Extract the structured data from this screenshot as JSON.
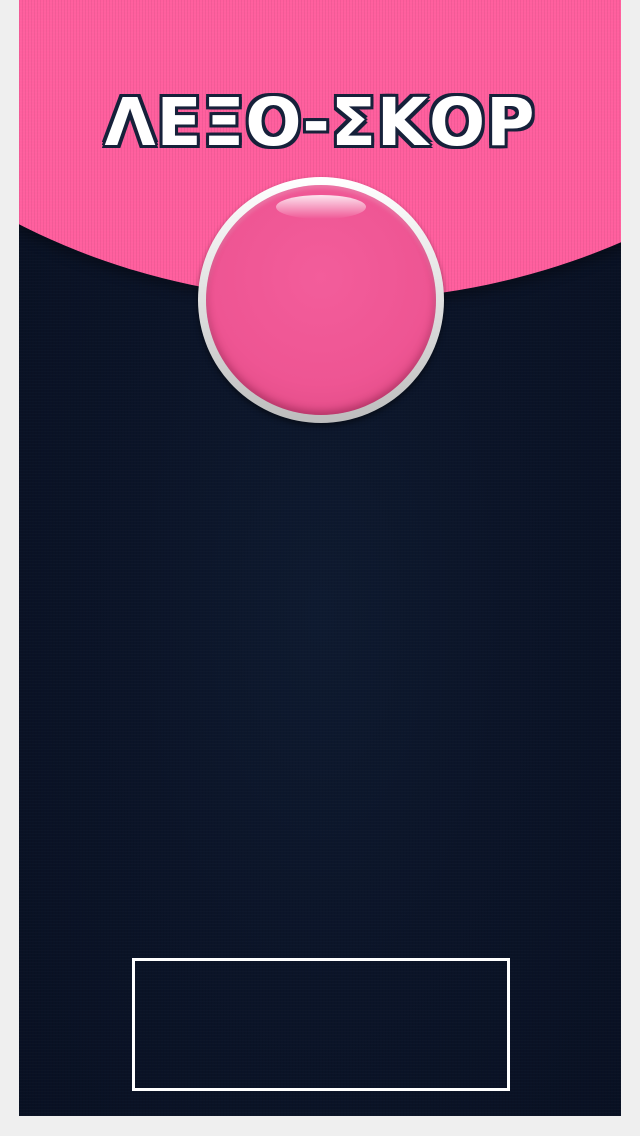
{
  "app": {
    "logo_text": "ΛΕΞΟ-ΣΚΟΡ"
  },
  "colors": {
    "header_pink": "#ff5f9e",
    "button_pink": "#ee5593",
    "board_navy": "#0b1428",
    "frame_gray": "#efefef",
    "score_border": "#ffffff"
  },
  "score_box": {
    "value": ""
  }
}
